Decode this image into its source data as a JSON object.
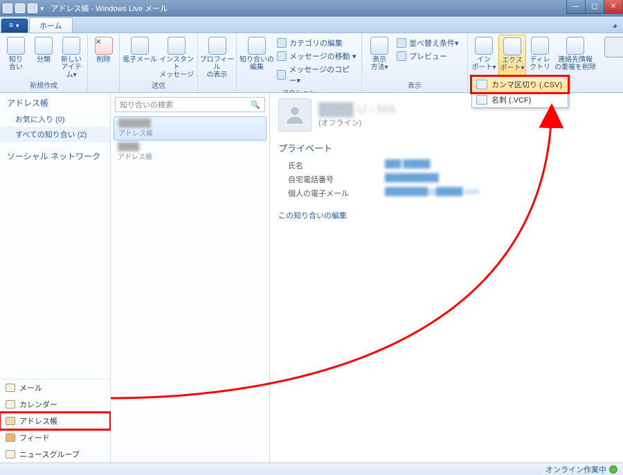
{
  "window": {
    "title": "アドレス帳 - Windows Live メール"
  },
  "tabs": {
    "file": "≡",
    "home": "ホーム"
  },
  "ribbon": {
    "groups": {
      "new": {
        "label": "新規作成",
        "contact": "知り\n合い",
        "category": "分類",
        "newitem": "新しい\nアイテム▾"
      },
      "delete": {
        "btn": "削除"
      },
      "send": {
        "label": "送信",
        "email": "電子メール",
        "im": "インスタント\nメッセージ"
      },
      "profile": {
        "btn": "プロフィール\nの表示"
      },
      "actions": {
        "label": "アクション",
        "editcontact": "知り合いの\n編集",
        "editcat": "カテゴリの編集",
        "movemsg": "メッセージの移動 ▾",
        "copymsg": "メッセージのコピー▾"
      },
      "view": {
        "label": "表示",
        "method": "表示\n方法▾",
        "sort": "並べ替え条件▾",
        "preview": "プレビュー"
      },
      "tools": {
        "import": "イン\nポート▾",
        "export": "エクス\nポート▾",
        "directory": "ディレ\nクトリ",
        "dedupe": "連絡先情報\nの重複を削除"
      }
    }
  },
  "dropdown": {
    "csv": "カンマ区切り (.CSV)",
    "vcf": "名刺 (.VCF)"
  },
  "leftnav": {
    "title": "アドレス帳",
    "favorites": "お気に入り (0)",
    "allcontacts": "すべての知り合い (2)",
    "social": "ソーシャル ネットワーク",
    "bottom": {
      "mail": "メール",
      "calendar": "カレンダー",
      "contacts": "アドレス帳",
      "feeds": "フィード",
      "news": "ニュースグループ"
    }
  },
  "mid": {
    "searchPlaceholder": "知り合いの検索",
    "items": [
      {
        "name": "██████",
        "sub": "アドレス帳"
      },
      {
        "name": "████",
        "sub": "アドレス帳"
      }
    ]
  },
  "content": {
    "name": "████ U☆MA",
    "offline": "(オフライン)",
    "section": "プライベート",
    "fields": {
      "fullname": {
        "label": "氏名",
        "value": "███ █████"
      },
      "homephone": {
        "label": "自宅電話番号",
        "value": "██████████"
      },
      "email": {
        "label": "個人の電子メール",
        "value": "████████@█████.com"
      }
    },
    "editlink": "この知り合いの編集"
  },
  "status": {
    "text": "オンライン作業中"
  }
}
